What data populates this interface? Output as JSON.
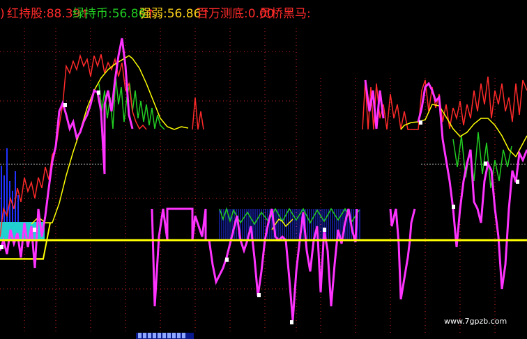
{
  "header": {
    "lead_glyph": ")",
    "items": [
      {
        "label": "红持股:",
        "value": "88.39",
        "color": "#ff2a2a",
        "arrow": "↑",
        "arrow_color": "#ff2a2a"
      },
      {
        "label": "绿持币:",
        "value": "56.86",
        "color": "#22cc22",
        "arrow": "↑",
        "arrow_color": "#ff2a2a"
      },
      {
        "label": "强弱:",
        "value": "56.86",
        "color": "#ffd21a",
        "arrow": "↑",
        "arrow_color": "#ff2a2a"
      },
      {
        "label": "百万测底:",
        "value": "0.00",
        "color": "#ff2a2a",
        "arrow": "",
        "arrow_color": ""
      },
      {
        "label": "灵桥黑马:",
        "value": "",
        "color": "#ff2a2a",
        "arrow": "",
        "arrow_color": ""
      }
    ]
  },
  "watermark": "www.7gpzb.com",
  "colors": {
    "red": "#ff2a2a",
    "green": "#22cc22",
    "yellow": "#ffff00",
    "magenta": "#ff33ff",
    "cyan": "#22d0d0",
    "blue": "#2233ff",
    "grid": "#ff2a2a"
  }
}
